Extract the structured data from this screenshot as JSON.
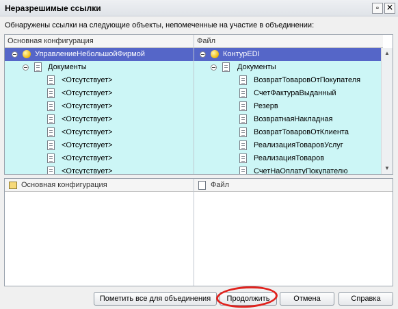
{
  "window": {
    "title": "Неразрешимые ссылки"
  },
  "description": "Обнаружены ссылки на следующие  объекты, непомеченные на участие в объединении:",
  "top_grid": {
    "col1_header": "Основная конфигурация",
    "col2_header": "Файл",
    "left": {
      "root": "УправлениеНебольшойФирмой",
      "group": "Документы",
      "items": [
        "<Отсутствует>",
        "<Отсутствует>",
        "<Отсутствует>",
        "<Отсутствует>",
        "<Отсутствует>",
        "<Отсутствует>",
        "<Отсутствует>",
        "<Отсутствует>"
      ]
    },
    "right": {
      "root": "КонтурEDI",
      "group": "Документы",
      "items": [
        "ВозвратТоваровОтПокупателя",
        "СчетФактураВыданный",
        "Резерв",
        "ВозвратнаяНакладная",
        "ВозвратТоваровОтКлиента",
        "РеализацияТоваровУслуг",
        "РеализацияТоваров",
        "СчетНаОплатуПокупателю"
      ]
    }
  },
  "bottom_grid": {
    "col1_header": "Основная конфигурация",
    "col2_header": "Файл"
  },
  "buttons": {
    "mark_all": "Пометить все для объединения",
    "continue": "Продолжить",
    "cancel": "Отмена",
    "help": "Справка"
  },
  "colors": {
    "selection": "#5566c8",
    "highlight": "#ccf6f6",
    "annotation": "#e0221d"
  }
}
